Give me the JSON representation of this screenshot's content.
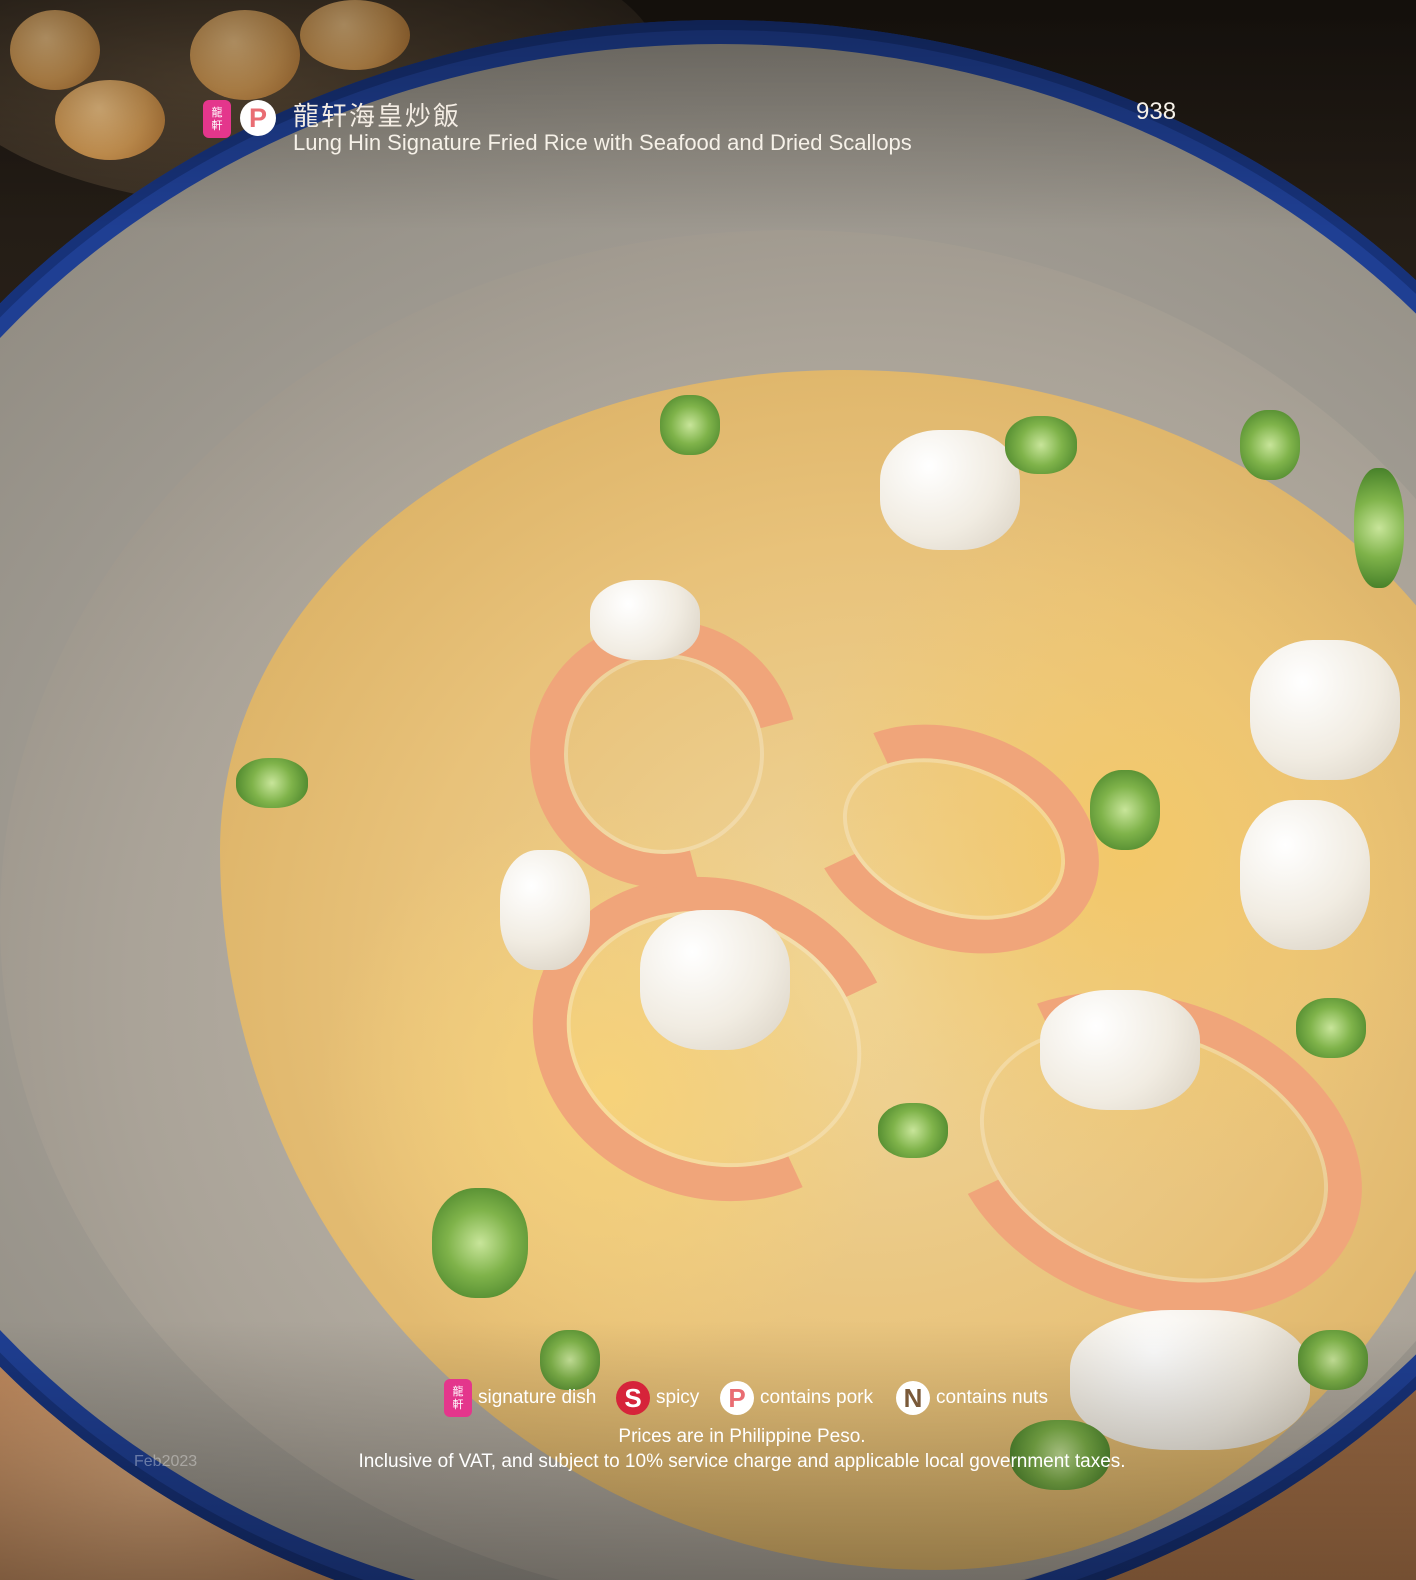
{
  "dish": {
    "name_cn": "龍轩海皇炒飯",
    "name_en": "Lung Hin Signature Fried Rice with Seafood and Dried Scallops",
    "price": "938",
    "badges": [
      "signature-badge-icon",
      "pork-icon"
    ]
  },
  "legend": {
    "signature": {
      "glyph": "龍\n軒",
      "label": "signature dish"
    },
    "spicy": {
      "glyph": "S",
      "label": "spicy"
    },
    "pork": {
      "glyph": "P",
      "label": "contains pork"
    },
    "nuts": {
      "glyph": "N",
      "label": "contains nuts"
    }
  },
  "notes": {
    "line1": "Prices are in Philippine Peso.",
    "line2": "Inclusive of VAT, and subject to 10% service charge and applicable local government taxes."
  },
  "edition": "Feb2023",
  "colors": {
    "signature_pink": "#e4368c",
    "pork_pink": "#e96d73",
    "spicy_red": "#d6243a",
    "bowl_blue": "#1f3f93"
  }
}
